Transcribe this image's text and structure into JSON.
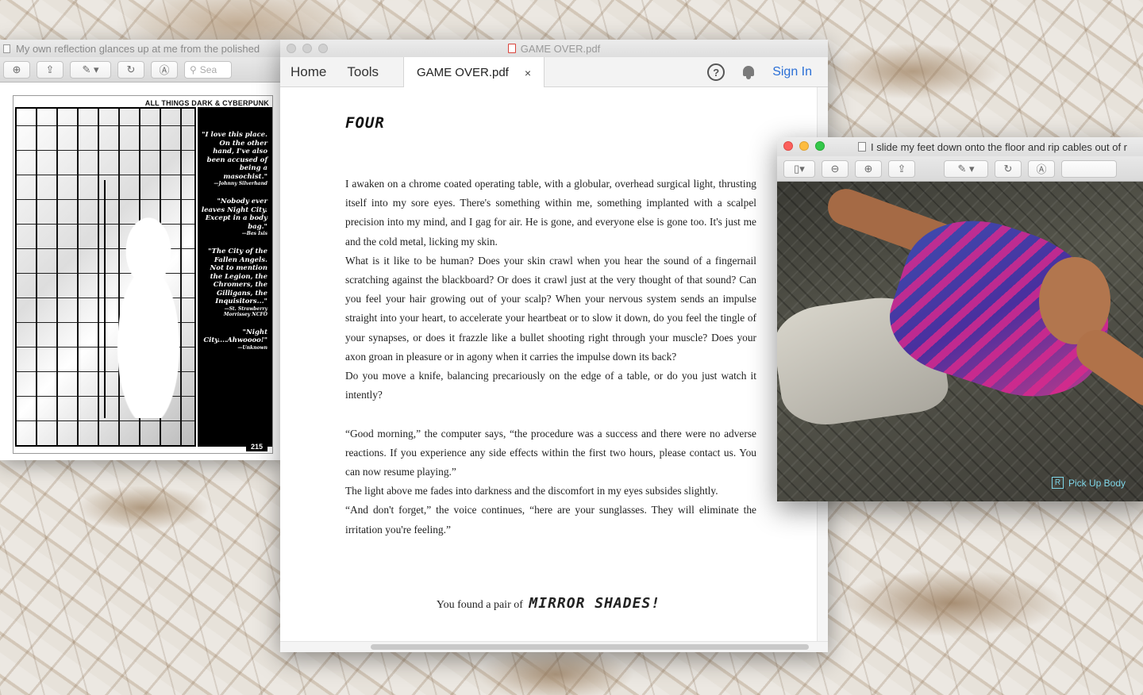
{
  "left_window": {
    "title": "My own reflection glances up at me from the polished",
    "search_placeholder": "Sea",
    "comic": {
      "header": "ALL THINGS DARK & CYBERPUNK",
      "quotes": [
        {
          "text": "\"I love this place. On the other hand, I've also been accused of being a masochist.\"",
          "attr": "—Johnny Silverhand"
        },
        {
          "text": "\"Nobody ever leaves Night City. Except in a body bag.\"",
          "attr": "—Bes Isis"
        },
        {
          "text": "\"The City of the Fallen Angels. Not to mention the Legion, the Chromers, the Gilligans, the Inquisitors...\"",
          "attr": "—St. Strawberry Morrissey NCFO"
        },
        {
          "text": "\"Night City....Ahwoooo!\"",
          "attr": "—Unknown"
        }
      ],
      "page_number": "215"
    }
  },
  "pdf_window": {
    "title": "GAME OVER.pdf",
    "nav": {
      "home": "Home",
      "tools": "Tools",
      "tab_label": "GAME OVER.pdf",
      "tab_close": "×",
      "help": "?",
      "sign_in": "Sign In"
    },
    "chapter": "FOUR",
    "paragraphs": [
      "I awaken on a chrome coated operating table, with a globular, overhead surgical light, thrusting itself into my sore eyes. There's something within me, something implanted with a scalpel precision into my mind, and I gag for air. He is gone, and everyone else is gone too. It's just me and the cold metal, licking my skin.",
      "What is it like to be human? Does your skin crawl when you hear the sound of a fingernail scratching against the blackboard? Or does it crawl just at the very thought of that sound? Can you feel your hair growing out of your scalp? When your nervous system sends an impulse straight into your heart, to accelerate your heartbeat or to slow it down, do you feel the tingle of your synapses, or does it frazzle like a bullet shooting right through your muscle? Does your axon groan in pleasure or in agony when it carries the impulse down its back?",
      "Do you move a knife, balancing precariously on the edge of a table, or do you just watch it intently?",
      "",
      "“Good morning,” the computer says, “the procedure was a success and there were no adverse reactions. If you experience any side effects within the first two hours, please contact us. You can now resume playing.”",
      "The light above me fades into darkness and the discomfort in my eyes subsides slightly.",
      "“And don't forget,” the voice continues, “here are your sunglasses. They will eliminate the irritation you're feeling.”"
    ],
    "found_prefix": "You found a pair of",
    "found_item": "MIRROR SHADES!"
  },
  "right_window": {
    "title": "I slide my feet down onto the floor and rip cables out of r",
    "prompt_key": "R",
    "prompt_text": "Pick Up Body"
  }
}
